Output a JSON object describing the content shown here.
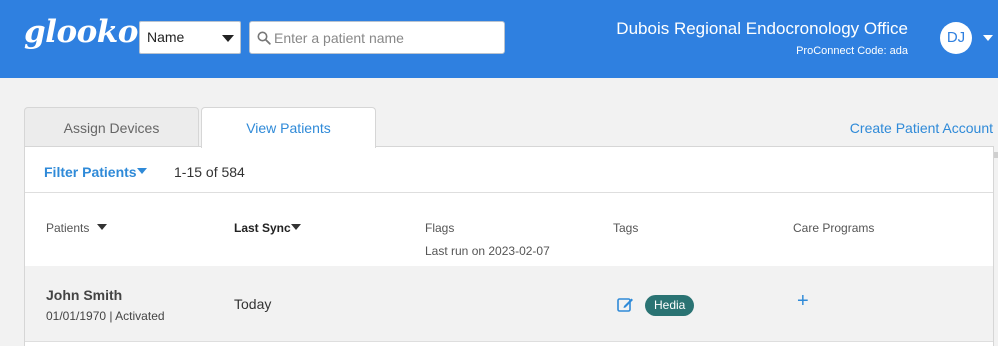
{
  "header": {
    "logo": "glooko",
    "search_type": "Name",
    "search_placeholder": "Enter a patient name",
    "office_name": "Dubois Regional Endocronology Office",
    "proconnect_code": "ProConnect Code: ada",
    "avatar_initials": "DJ"
  },
  "tabs": [
    {
      "label": "Assign Devices",
      "active": false
    },
    {
      "label": "View Patients",
      "active": true
    }
  ],
  "create_patient_label": "Create Patient Account",
  "toolbar": {
    "filter_label": "Filter Patients",
    "range_text": "1-15 of 584"
  },
  "table": {
    "columns": {
      "patients": "Patients",
      "last_sync": "Last Sync",
      "flags": "Flags",
      "flags_sub": "Last run on 2023-02-07",
      "tags": "Tags",
      "care_programs": "Care Programs"
    },
    "rows": [
      {
        "name": "John Smith",
        "dob_status": "01/01/1970 | Activated",
        "last_sync": "Today",
        "tag": "Hedia",
        "add": "+"
      }
    ]
  },
  "colors": {
    "header_bg": "#2f80e0",
    "link": "#2f8ad8",
    "tag_bg": "#2a7373"
  }
}
